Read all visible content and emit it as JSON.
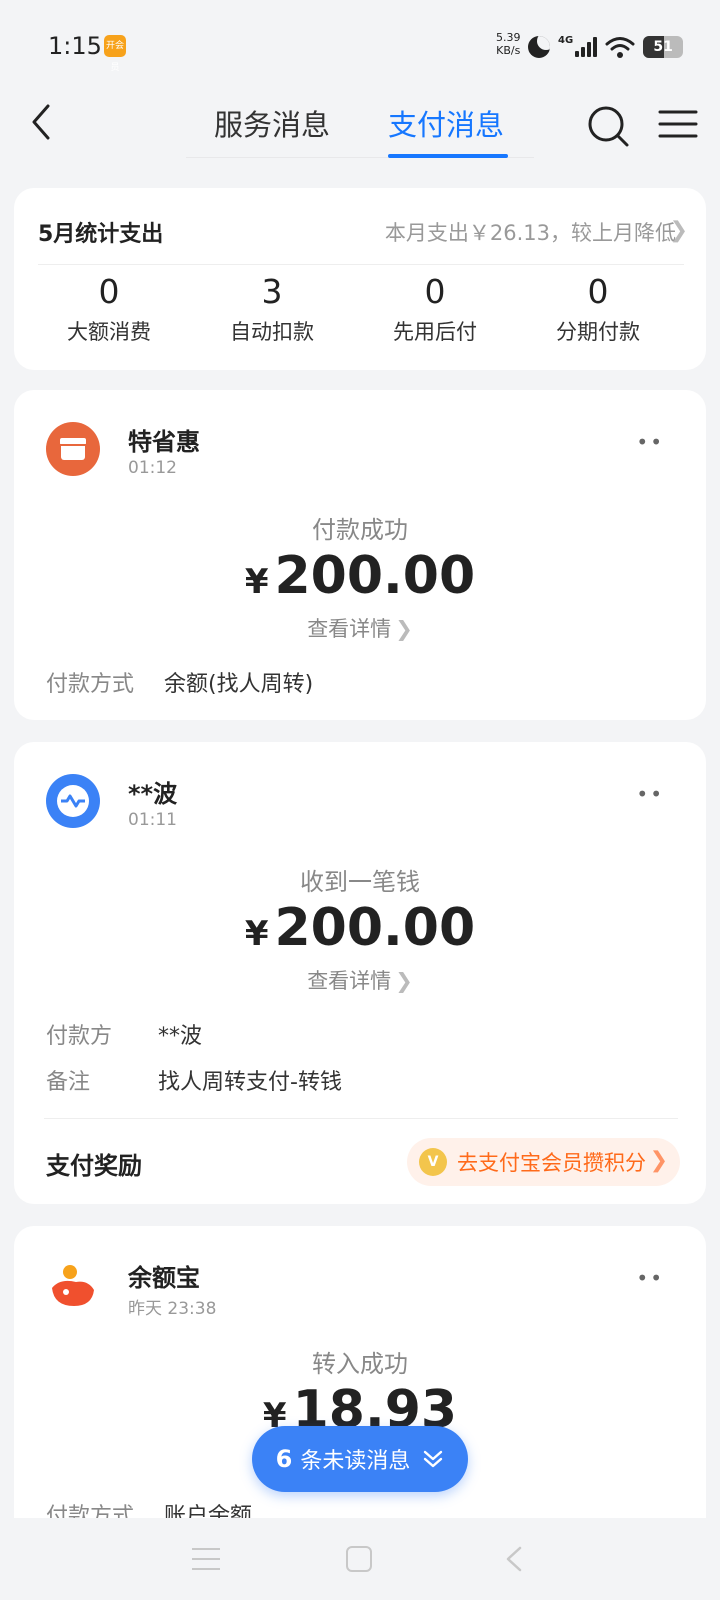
{
  "status_bar": {
    "time": "1:15",
    "app_badge": "开会员",
    "speed_value": "5.39",
    "speed_unit": "KB/s",
    "network": "4G",
    "battery": "51",
    "battery_level": 0.51
  },
  "header": {
    "tabs": [
      {
        "label": "服务消息",
        "active": false
      },
      {
        "label": "支付消息",
        "active": true
      }
    ],
    "accent_color": "#1677ff"
  },
  "summary": {
    "title": "5月统计支出",
    "hint": "本月支出￥26.13，较上月降低",
    "stats": [
      {
        "value": "0",
        "label": "大额消费"
      },
      {
        "value": "3",
        "label": "自动扣款"
      },
      {
        "value": "0",
        "label": "先用后付"
      },
      {
        "value": "0",
        "label": "分期付款"
      }
    ]
  },
  "messages": [
    {
      "sender": "特省惠",
      "time": "01:12",
      "avatar_icon": "store-icon",
      "avatar_color": "#e8673c",
      "more": "••",
      "status": "付款成功",
      "currency": "¥",
      "amount": "200.00",
      "detail": "查看详情",
      "rows": [
        {
          "key": "付款方式",
          "value": "余额(找人周转)"
        }
      ]
    },
    {
      "sender": "**波",
      "time": "01:11",
      "avatar_icon": "transfer-icon",
      "avatar_color": "#3b82f6",
      "more": "••",
      "status": "收到一笔钱",
      "currency": "¥",
      "amount": "200.00",
      "detail": "查看详情",
      "rows": [
        {
          "key": "付款方",
          "value": "**波"
        },
        {
          "key": "备注",
          "value": "找人周转支付-转钱"
        }
      ],
      "reward_title": "支付奖励",
      "reward_coin": "V",
      "reward_label": "去支付宝会员攒积分"
    },
    {
      "sender": "余额宝",
      "time": "昨天 23:38",
      "avatar_icon": "yuebao-icon",
      "avatar_color": "#f0502e",
      "more": "••",
      "status": "转入成功",
      "currency": "¥",
      "amount": "18.93",
      "rows": [
        {
          "key": "付款方式",
          "value": "账户余额"
        }
      ]
    }
  ],
  "unread": {
    "count": "6",
    "label": "条未读消息"
  }
}
